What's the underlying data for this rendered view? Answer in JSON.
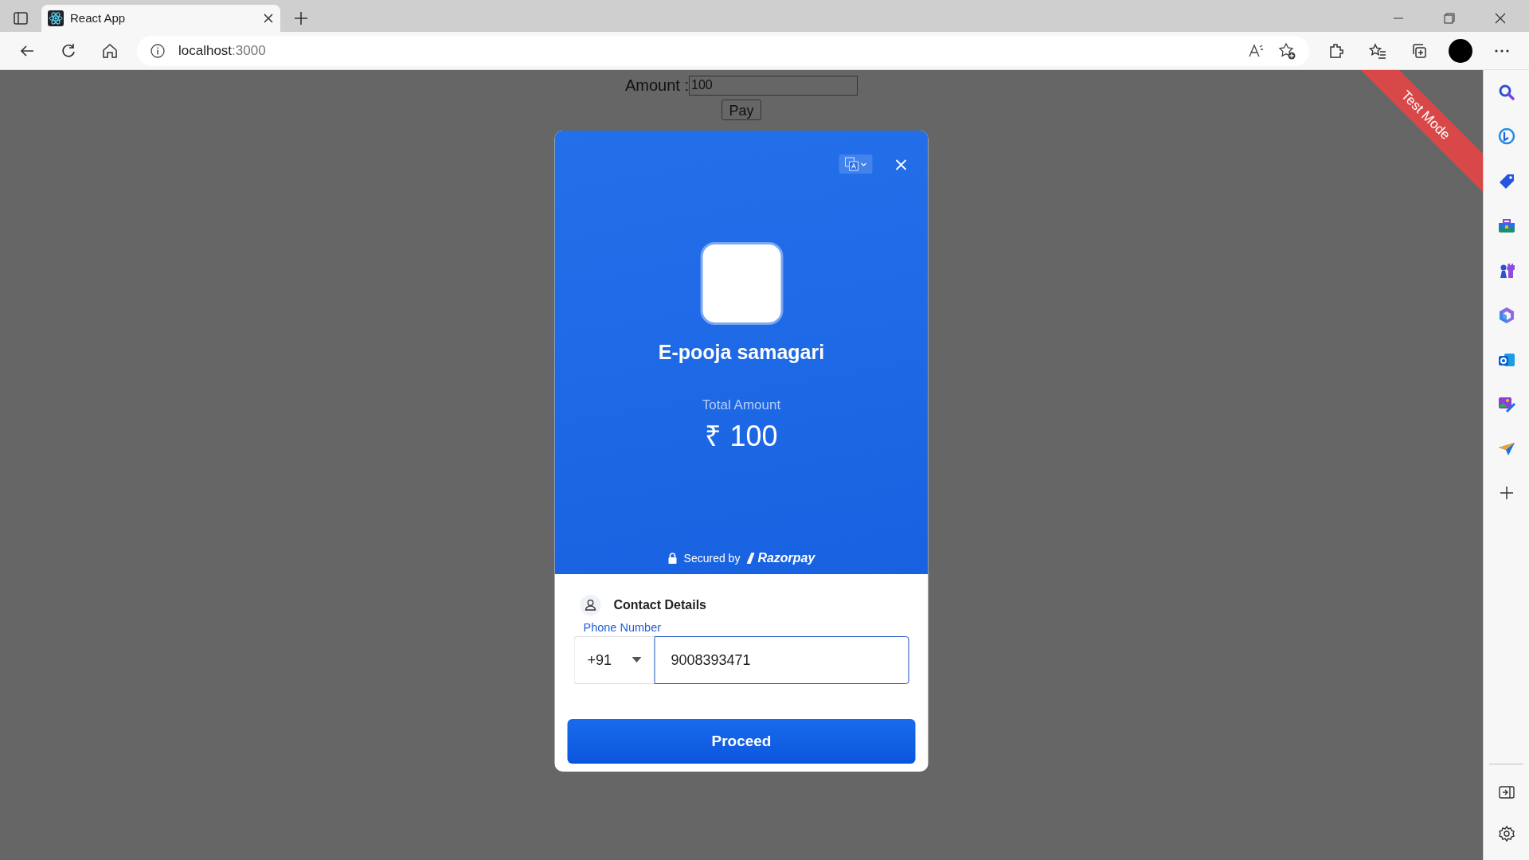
{
  "browser": {
    "tabs": [
      {
        "title": "React App",
        "selected": true
      }
    ],
    "address": {
      "host": "localhost",
      "port": ":3000"
    }
  },
  "page": {
    "amount_label": "Amount :",
    "amount_value": "100",
    "pay_button": "Pay"
  },
  "checkout": {
    "merchant": "E-pooja samagari",
    "total_label": "Total Amount",
    "total": "₹ 100",
    "secured_by": "Secured by",
    "brand": "Razorpay",
    "contact_heading": "Contact Details",
    "phone_label": "Phone Number",
    "country_code": "+91",
    "phone_value": "9008393471",
    "proceed": "Proceed"
  },
  "test_mode_ribbon": "Test Mode"
}
